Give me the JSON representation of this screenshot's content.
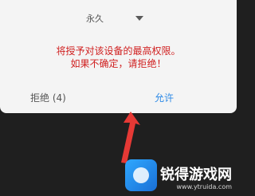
{
  "dialog": {
    "duration_selected": "永久",
    "warning_lines": [
      "将授予对该设备的最高权限。",
      "如果不确定，请拒绝！"
    ],
    "deny_label": "拒绝 (4)",
    "allow_label": "允许"
  },
  "colors": {
    "warning": "#d01f1f",
    "allow": "#2e8ae6",
    "arrow": "#e53935"
  },
  "watermark": {
    "title": "锐得游戏网",
    "url": "www.ytruida.com"
  }
}
